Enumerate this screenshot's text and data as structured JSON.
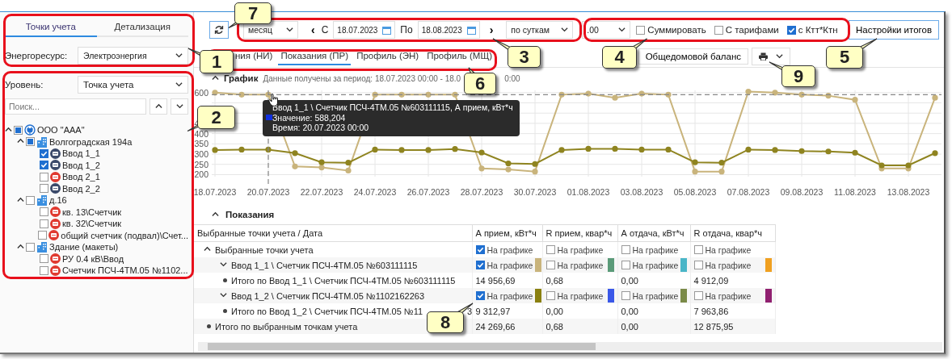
{
  "left_panel": {
    "tabs": [
      {
        "label": "Точки учета",
        "selected": true
      },
      {
        "label": "Детализация",
        "selected": false
      }
    ],
    "energy_resource": {
      "label": "Энергоресурс:",
      "value": "Электроэнергия"
    },
    "level": {
      "label": "Уровень:",
      "value": "Точка учета"
    },
    "search": {
      "placeholder": "Поиск..."
    },
    "tree": [
      {
        "label": "ООО \"ААА\"",
        "kind": "company",
        "checked": false,
        "partial": true,
        "expanded": true,
        "children": [
          {
            "label": "Волгоградская 194а",
            "kind": "building",
            "checked": false,
            "partial": true,
            "expanded": true,
            "children": [
              {
                "label": "Ввод 1_1",
                "kind": "meter",
                "color": "#3b4a6a",
                "checked": true
              },
              {
                "label": "Ввод 1_2",
                "kind": "meter",
                "color": "#3b4a6a",
                "checked": true
              },
              {
                "label": "Ввод 2_1",
                "kind": "meter",
                "color": "#e03a30",
                "checked": false,
                "partial": false
              },
              {
                "label": "Ввод 2_2",
                "kind": "meter",
                "color": "#3b4a6a",
                "checked": false,
                "partial": false
              }
            ]
          },
          {
            "label": "д.16",
            "kind": "building",
            "checked": false,
            "partial": false,
            "expanded": true,
            "children": [
              {
                "label": "кв. 13\\Счетчик",
                "kind": "meter",
                "color": "#e03a30",
                "checked": false,
                "partial": false
              },
              {
                "label": "кв. 32\\Счетчик",
                "kind": "meter",
                "color": "#e03a30",
                "checked": false,
                "partial": false
              },
              {
                "label": "общий счетчик (подвал)\\Счет...",
                "kind": "meter",
                "color": "#e03a30",
                "checked": false,
                "partial": false
              }
            ]
          },
          {
            "label": "Здание (макеты)",
            "kind": "building",
            "checked": false,
            "partial": false,
            "expanded": true,
            "children": [
              {
                "label": "РУ 0.4 кВ\\Ввод",
                "kind": "meter",
                "color": "#e03a30",
                "checked": false,
                "partial": false
              },
              {
                "label": "Счетчик ПСЧ-4ТМ.05 №1102...",
                "kind": "meter",
                "color": "#e03a30",
                "checked": false,
                "partial": false
              }
            ]
          }
        ]
      }
    ]
  },
  "toolbar": {
    "period": "месяц",
    "prev": "‹",
    "from_label": "С",
    "from": "18.07.2023",
    "to_label": "По",
    "to": "18.08.2023",
    "next": "›",
    "step": "по суткам",
    "precision": ".00",
    "checkboxes": [
      {
        "label": "Суммировать",
        "checked": false
      },
      {
        "label": "С тарифами",
        "checked": false
      },
      {
        "label": "с Ктт*Ктн",
        "checked": true
      }
    ],
    "settings_button": "Настройки итогов"
  },
  "view_tabs": [
    {
      "label": "ния (НИ)",
      "selected": false
    },
    {
      "label": "Показания (ПР)",
      "selected": true
    },
    {
      "label": "Профиль (ЭН)",
      "selected": false
    },
    {
      "label": "Профиль (МЩ)",
      "selected": false
    }
  ],
  "balance_button": "Общедомовой баланс",
  "chart_section": {
    "title": "График",
    "period_text": "Данные получены за период: 18.07.2023 00:00 - 18.0",
    "period_text_tail": "0:00",
    "chart_data": {
      "type": "line",
      "categories": [
        "18.07.2023",
        null,
        "20.07.2023",
        null,
        "22.07.2023",
        null,
        "24.07.2023",
        null,
        "26.07.2023",
        null,
        "28.07.2023",
        null,
        "30.07.2023",
        null,
        "01.08.2023",
        null,
        "03.08.2023",
        null,
        "05.08.2023",
        null,
        "07.08.2023",
        null,
        "09.08.2023",
        null,
        "11.08.2023",
        null,
        "13.08.2023",
        null
      ],
      "series": [
        {
          "color": "#c9b47c",
          "marker": "circle",
          "values": [
            600,
            590,
            590,
            240,
            235,
            220,
            590,
            590,
            590,
            590,
            230,
            225,
            215,
            590,
            595,
            575,
            595,
            590,
            215,
            215,
            605,
            600,
            590,
            585,
            565,
            230,
            230,
            575
          ]
        },
        {
          "color": "#8f8420",
          "marker": "circle",
          "values": [
            320,
            322,
            322,
            305,
            260,
            258,
            322,
            320,
            320,
            325,
            308,
            255,
            252,
            320,
            326,
            326,
            322,
            322,
            260,
            258,
            322,
            320,
            315,
            313,
            307,
            245,
            245,
            305
          ]
        }
      ],
      "grid": true,
      "ref_lines": [
        {
          "axis": "y",
          "value": 590
        }
      ],
      "ylim": [
        190,
        615
      ],
      "yticks": [
        200,
        250,
        300,
        350,
        400,
        450,
        600
      ]
    },
    "tooltip": {
      "title": "Ввод 1_1 \\ Счетчик ПСЧ-4ТМ.05 №603111115, А прием, кВт*ч",
      "value": "Значение: 588,204",
      "time": "Время: 20.07.2023 00:00"
    }
  },
  "readings_section": {
    "title": "Показания",
    "columns": [
      "Выбранные точки учета / Дата",
      "А прием, кВт*ч",
      "R прием, квар*ч",
      "А отдача, кВт*ч",
      "R отдача, квар*ч"
    ],
    "rows": [
      {
        "kind": "group",
        "expanded": true,
        "cells": [
          {
            "kind": "label",
            "text": "Выбранные точки учета"
          },
          {
            "kind": "toggle",
            "label": "На графике",
            "checked": true
          },
          {
            "kind": "toggle",
            "label": "На графике",
            "checked": false
          },
          {
            "kind": "toggle",
            "label": "На графике",
            "checked": false
          },
          {
            "kind": "toggle",
            "label": "На графике",
            "checked": false
          }
        ]
      },
      {
        "kind": "meter",
        "expanded": false,
        "cells": [
          {
            "kind": "label",
            "text": "Ввод 1_1 \\ Счетчик ПСЧ-4ТМ.05 №603111115"
          },
          {
            "kind": "toggle",
            "label": "На графике",
            "checked": true,
            "color": "#c9b47c"
          },
          {
            "kind": "toggle",
            "label": "На графике",
            "checked": false,
            "color": "#5a9a78"
          },
          {
            "kind": "toggle",
            "label": "На графике",
            "checked": false,
            "color": "#4ab6c8"
          },
          {
            "kind": "toggle",
            "label": "На графике",
            "checked": false,
            "color": "#f0a020"
          }
        ]
      },
      {
        "kind": "total",
        "cells": [
          {
            "kind": "label",
            "text": "Итого по Ввод 1_1 \\ Счетчик ПСЧ-4ТМ.05 №603111115"
          },
          {
            "kind": "value",
            "value": "14 956,69"
          },
          {
            "kind": "value",
            "value": "0,68"
          },
          {
            "kind": "value",
            "value": "0,00"
          },
          {
            "kind": "value",
            "value": "4 912,09"
          }
        ]
      },
      {
        "kind": "meter",
        "expanded": false,
        "cells": [
          {
            "kind": "label",
            "text": "Ввод 1_2 \\ Счетчик ПСЧ-4ТМ.05 №1102162263"
          },
          {
            "kind": "toggle",
            "label": "На графике",
            "checked": true,
            "color": "#8a8010"
          },
          {
            "kind": "toggle",
            "label": "На графике",
            "checked": false,
            "color": "#3a58e8"
          },
          {
            "kind": "toggle",
            "label": "На графике",
            "checked": false,
            "color": "#7a8a48"
          },
          {
            "kind": "toggle",
            "label": "На графике",
            "checked": false,
            "color": "#902070"
          }
        ]
      },
      {
        "kind": "total",
        "cells": [
          {
            "kind": "label",
            "text": "Итого по Ввод 1_2 \\ Счетчик ПСЧ-4ТМ.05 №11",
            "tail": "3"
          },
          {
            "kind": "value",
            "value": "9 312,97"
          },
          {
            "kind": "value",
            "value": "0,00"
          },
          {
            "kind": "value",
            "value": "0,00"
          },
          {
            "kind": "value",
            "value": "7 963,86"
          }
        ]
      },
      {
        "kind": "grand_total",
        "cells": [
          {
            "kind": "label",
            "text": "Итого по выбранным точкам учета"
          },
          {
            "kind": "value",
            "value": "24 269,66"
          },
          {
            "kind": "value",
            "value": "0,68"
          },
          {
            "kind": "value",
            "value": "0,00"
          },
          {
            "kind": "value",
            "value": "12 875,95"
          }
        ]
      }
    ]
  },
  "callouts": [
    {
      "number": "1"
    },
    {
      "number": "2"
    },
    {
      "number": "3"
    },
    {
      "number": "4"
    },
    {
      "number": "5"
    },
    {
      "number": "6"
    },
    {
      "number": "7"
    },
    {
      "number": "8"
    },
    {
      "number": "9"
    }
  ]
}
